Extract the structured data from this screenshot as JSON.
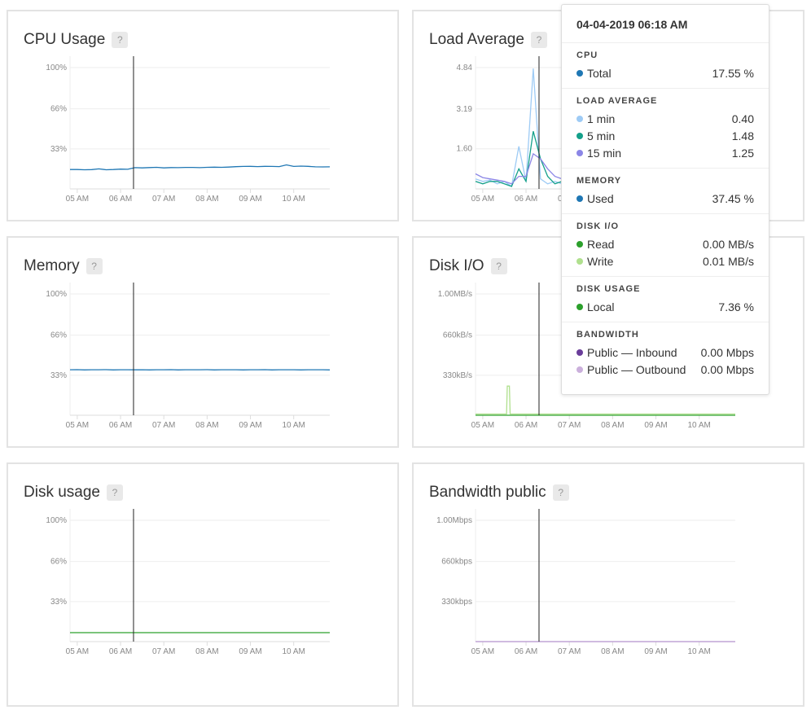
{
  "tooltip": {
    "timestamp": "04-04-2019 06:18 AM",
    "sections": [
      {
        "title": "CPU",
        "rows": [
          {
            "label": "Total",
            "value": "17.55 %",
            "color": "#1f77b4"
          }
        ]
      },
      {
        "title": "LOAD AVERAGE",
        "rows": [
          {
            "label": "1 min",
            "value": "0.40",
            "color": "#9ecbf5"
          },
          {
            "label": "5 min",
            "value": "1.48",
            "color": "#14a08a"
          },
          {
            "label": "15 min",
            "value": "1.25",
            "color": "#8b86e6"
          }
        ]
      },
      {
        "title": "MEMORY",
        "rows": [
          {
            "label": "Used",
            "value": "37.45 %",
            "color": "#1f77b4"
          }
        ]
      },
      {
        "title": "DISK I/O",
        "rows": [
          {
            "label": "Read",
            "value": "0.00 MB/s",
            "color": "#2ca02c"
          },
          {
            "label": "Write",
            "value": "0.01 MB/s",
            "color": "#b0e08e"
          }
        ]
      },
      {
        "title": "DISK USAGE",
        "rows": [
          {
            "label": "Local",
            "value": "7.36 %",
            "color": "#2ca02c"
          }
        ]
      },
      {
        "title": "BANDWIDTH",
        "rows": [
          {
            "label": "Public — Inbound",
            "value": "0.00 Mbps",
            "color": "#6a3d9a"
          },
          {
            "label": "Public — Outbound",
            "value": "0.00 Mbps",
            "color": "#cbb0dc"
          }
        ]
      }
    ]
  },
  "help_label": "?",
  "chart_data": [
    {
      "id": "cpu",
      "type": "line",
      "title": "CPU Usage",
      "yticks": [
        {
          "label": "100%",
          "value": 100
        },
        {
          "label": "66%",
          "value": 66
        },
        {
          "label": "33%",
          "value": 33
        }
      ],
      "x_range": [
        "04:50",
        "10:50"
      ],
      "x_step_minutes": 10,
      "xticks": [
        "05 AM",
        "06 AM",
        "07 AM",
        "08 AM",
        "09 AM",
        "10 AM"
      ],
      "cursor": "06:18",
      "series": [
        {
          "color": "#1f77b4",
          "values": [
            16,
            16,
            15.8,
            15.9,
            16.5,
            15.8,
            16,
            16.3,
            16.2,
            17.5,
            17.3,
            17.6,
            17.8,
            17.3,
            17.6,
            17.5,
            17.7,
            17.7,
            17.5,
            17.8,
            17.9,
            17.8,
            18,
            18.3,
            18.5,
            18.6,
            18.4,
            18.6,
            18.5,
            18.4,
            19.8,
            18.5,
            18.8,
            18.6,
            18.2,
            18.1,
            18.2
          ]
        }
      ]
    },
    {
      "id": "load",
      "type": "line",
      "title": "Load Average",
      "yticks": [
        {
          "label": "4.84",
          "value": 4.84
        },
        {
          "label": "3.19",
          "value": 3.19
        },
        {
          "label": "1.60",
          "value": 1.6
        }
      ],
      "x_range": [
        "04:50",
        "10:50"
      ],
      "x_step_minutes": 10,
      "xticks": [
        "05 AM",
        "06 AM",
        "07 AM",
        "08 AM",
        "09 AM",
        "10 AM"
      ],
      "cursor": "06:18",
      "series": [
        {
          "name": "1 min",
          "color": "#9ecbf5",
          "values": [
            0.4,
            0.3,
            0.35,
            0.2,
            0.3,
            0.1,
            1.7,
            0.3,
            4.8,
            0.4,
            0.2,
            0.3,
            0.2,
            0.3,
            0.25,
            0.3,
            0.3,
            0.2,
            0.3,
            0.25,
            0.3,
            0.3,
            0.2,
            0.3,
            0.3,
            0.25,
            0.3,
            0.2,
            0.3,
            0.3,
            0.25,
            0.3,
            0.2,
            0.3,
            0.3,
            0.2,
            0.3
          ]
        },
        {
          "name": "5 min",
          "color": "#14a08a",
          "values": [
            0.3,
            0.2,
            0.3,
            0.3,
            0.2,
            0.1,
            0.8,
            0.3,
            2.3,
            1.2,
            0.5,
            0.2,
            0.3,
            0.3,
            0.3,
            0.3,
            0.3,
            0.3,
            0.3,
            0.3,
            0.3,
            0.3,
            0.3,
            0.3,
            0.3,
            0.3,
            0.3,
            0.3,
            0.3,
            0.3,
            0.3,
            0.3,
            0.3,
            0.3,
            0.3,
            0.3,
            0.3
          ]
        },
        {
          "name": "15 min",
          "color": "#8b86e6",
          "values": [
            0.6,
            0.45,
            0.4,
            0.35,
            0.3,
            0.2,
            0.5,
            0.5,
            1.4,
            1.2,
            0.8,
            0.5,
            0.4,
            0.35,
            0.35,
            0.35,
            0.35,
            0.35,
            0.35,
            0.35,
            0.35,
            0.35,
            0.35,
            0.35,
            0.35,
            0.35,
            0.35,
            0.35,
            0.35,
            0.35,
            0.35,
            0.35,
            0.35,
            0.35,
            0.35,
            0.35,
            0.35
          ]
        }
      ]
    },
    {
      "id": "memory",
      "type": "line",
      "title": "Memory",
      "yticks": [
        {
          "label": "100%",
          "value": 100
        },
        {
          "label": "66%",
          "value": 66
        },
        {
          "label": "33%",
          "value": 33
        }
      ],
      "x_range": [
        "04:50",
        "10:50"
      ],
      "x_step_minutes": 10,
      "xticks": [
        "05 AM",
        "06 AM",
        "07 AM",
        "08 AM",
        "09 AM",
        "10 AM"
      ],
      "cursor": "06:18",
      "series": [
        {
          "color": "#1f77b4",
          "values": [
            37.5,
            37.6,
            37.4,
            37.5,
            37.5,
            37.6,
            37.4,
            37.5,
            37.5,
            37.45,
            37.5,
            37.4,
            37.5,
            37.5,
            37.6,
            37.4,
            37.5,
            37.5,
            37.5,
            37.6,
            37.4,
            37.5,
            37.5,
            37.5,
            37.4,
            37.5,
            37.5,
            37.6,
            37.4,
            37.5,
            37.5,
            37.5,
            37.4,
            37.5,
            37.5,
            37.5,
            37.4
          ]
        }
      ]
    },
    {
      "id": "diskio",
      "type": "line",
      "title": "Disk I/O",
      "yticks": [
        {
          "label": "1.00MB/s",
          "value": 1
        },
        {
          "label": "660kB/s",
          "value": 0.66
        },
        {
          "label": "330kB/s",
          "value": 0.33
        }
      ],
      "x_range": [
        "04:50",
        "10:50"
      ],
      "x_step_minutes": 10,
      "xticks": [
        "05 AM",
        "06 AM",
        "07 AM",
        "08 AM",
        "09 AM",
        "10 AM"
      ],
      "cursor": "06:18",
      "series": [
        {
          "name": "Read",
          "color": "#2ca02c",
          "values": [
            0,
            0,
            0,
            0,
            0,
            0,
            0,
            0,
            0,
            0,
            0,
            0,
            0,
            0,
            0,
            0,
            0,
            0,
            0,
            0,
            0,
            0,
            0,
            0,
            0,
            0,
            0,
            0,
            0,
            0,
            0,
            0,
            0,
            0,
            0,
            0,
            0
          ]
        },
        {
          "name": "Write",
          "color": "#b0e08e",
          "values": [
            0.01,
            0.01,
            0.01,
            0.01,
            0.01,
            0.01,
            0.01,
            0.01,
            0.01,
            0.01,
            0.01,
            0.01,
            0.01,
            0.01,
            0.01,
            0.01,
            0.01,
            0.01,
            0.01,
            0.01,
            0.01,
            0.01,
            0.01,
            0.01,
            0.01,
            0.01,
            0.01,
            0.01,
            0.01,
            0.01,
            0.01,
            0.01,
            0.01,
            0.01,
            0.01,
            0.01,
            0.01
          ],
          "spike": {
            "at": "05:36",
            "value": 0.24
          }
        }
      ]
    },
    {
      "id": "disk",
      "type": "line",
      "title": "Disk usage",
      "yticks": [
        {
          "label": "100%",
          "value": 100
        },
        {
          "label": "66%",
          "value": 66
        },
        {
          "label": "33%",
          "value": 33
        }
      ],
      "x_range": [
        "04:50",
        "10:50"
      ],
      "x_step_minutes": 10,
      "xticks": [
        "05 AM",
        "06 AM",
        "07 AM",
        "08 AM",
        "09 AM",
        "10 AM"
      ],
      "cursor": "06:18",
      "series": [
        {
          "color": "#2ca02c",
          "values": [
            7.36,
            7.36,
            7.36,
            7.36,
            7.36,
            7.36,
            7.36,
            7.36,
            7.36,
            7.36,
            7.36,
            7.36,
            7.36,
            7.36,
            7.36,
            7.36,
            7.36,
            7.36,
            7.36,
            7.36,
            7.36,
            7.36,
            7.36,
            7.36,
            7.36,
            7.36,
            7.36,
            7.36,
            7.36,
            7.36,
            7.36,
            7.36,
            7.36,
            7.36,
            7.36,
            7.36,
            7.36
          ]
        }
      ]
    },
    {
      "id": "bandwidth",
      "type": "line",
      "title": "Bandwidth public",
      "yticks": [
        {
          "label": "1.00Mbps",
          "value": 1
        },
        {
          "label": "660kbps",
          "value": 0.66
        },
        {
          "label": "330kbps",
          "value": 0.33
        }
      ],
      "x_range": [
        "04:50",
        "10:50"
      ],
      "x_step_minutes": 10,
      "xticks": [
        "05 AM",
        "06 AM",
        "07 AM",
        "08 AM",
        "09 AM",
        "10 AM"
      ],
      "cursor": "06:18",
      "series": [
        {
          "name": "Public — Inbound",
          "color": "#6a3d9a",
          "values": [
            0,
            0,
            0,
            0,
            0,
            0,
            0,
            0,
            0,
            0,
            0,
            0,
            0,
            0,
            0,
            0,
            0,
            0,
            0,
            0,
            0,
            0,
            0,
            0,
            0,
            0,
            0,
            0,
            0,
            0,
            0,
            0,
            0,
            0,
            0,
            0,
            0
          ]
        },
        {
          "name": "Public — Outbound",
          "color": "#cbb0dc",
          "values": [
            0,
            0,
            0,
            0,
            0,
            0,
            0,
            0,
            0,
            0,
            0,
            0,
            0,
            0,
            0,
            0,
            0,
            0,
            0,
            0,
            0,
            0,
            0,
            0,
            0,
            0,
            0,
            0,
            0,
            0,
            0,
            0,
            0,
            0,
            0,
            0,
            0
          ]
        }
      ]
    }
  ]
}
